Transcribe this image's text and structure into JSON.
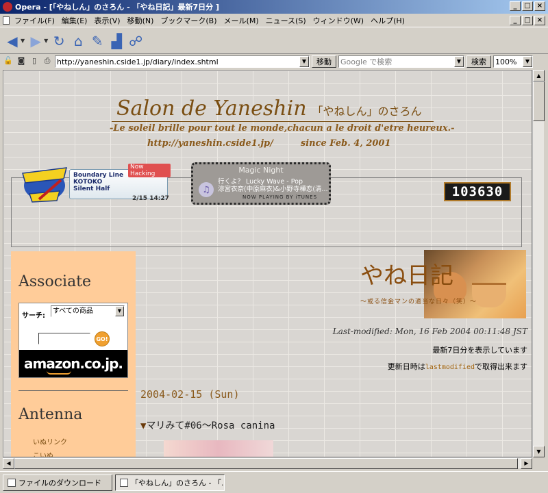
{
  "window": {
    "title": "Opera - [「やねしん」のさろん - 「やね日記」最新7日分 ]",
    "controls": [
      "_",
      "□",
      "×"
    ]
  },
  "menu": [
    "ファイル(F)",
    "編集(E)",
    "表示(V)",
    "移動(N)",
    "ブックマーク(B)",
    "メール(M)",
    "ニュース(S)",
    "ウィンドウ(W)",
    "ヘルプ(H)"
  ],
  "address": {
    "url": "http://yaneshin.cside1.jp/diary/index.shtml",
    "go_label": "移動",
    "search_placeholder": "Google で検索",
    "search_button": "検索",
    "zoom": "100%"
  },
  "page": {
    "site_title": "Salon de Yaneshin",
    "site_title_jp": "「やねしん」のさろん",
    "motto": "-Le soleil brille pour tout le monde,chacun a le droit d'etre heureux.-",
    "site_url": "http://yaneshin.cside1.jp/",
    "since": "since  Feb. 4, 2001",
    "hyperhack": {
      "badge": "Now Hacking",
      "tracks": [
        "Boundary Line",
        "KOTOKO",
        "Silent Half"
      ],
      "time": "2/15 14:27"
    },
    "itunes": {
      "title": "Magic Night",
      "line1": "行くよ？ Lucky Wave - Pop",
      "line2": "涼宮衣奈(中原麻衣)&小野寺樺恋(清...",
      "footer": "NOW PLAYING BY iTUNES"
    },
    "counter": "103630",
    "sidebar": {
      "associate_heading": "Associate",
      "search_label": "サーチ:",
      "search_select": "すべての商品",
      "go_label": "GO!",
      "amazon_logo": "amazon.co.jp.",
      "antenna_heading": "Antenna",
      "antenna_links": [
        "いぬリンク",
        "こいぬ"
      ]
    },
    "diary": {
      "title": "やね日記",
      "subtitle": "〜或る信金マンの適当な日々（笑）〜",
      "last_modified": "Last-modified: Mon, 16 Feb 2004 00:11:48 JST",
      "showing": "最新7日分を表示しています",
      "update_prefix": "更新日時は",
      "update_code": "lastmodified",
      "update_suffix": "で取得出来ます",
      "date": "2004-02-15 (Sun)",
      "entry_title": "マリみて#06〜Rosa canina"
    }
  },
  "taskbar": {
    "downloads": "ファイルのダウンロード",
    "active_tab": "「やねしん」のさろん - 「..."
  }
}
